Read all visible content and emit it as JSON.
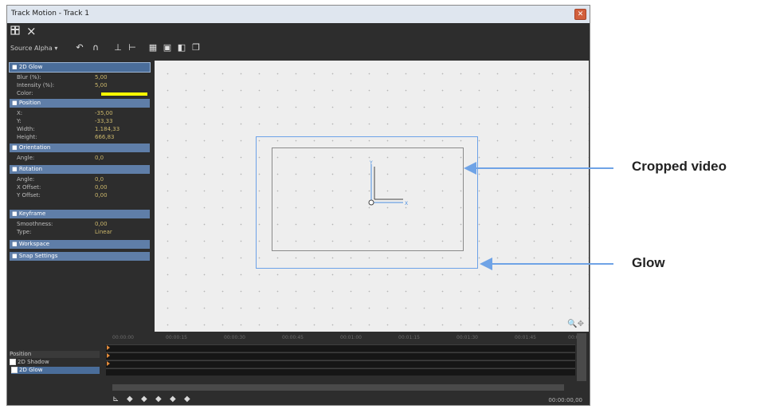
{
  "window": {
    "title": "Track Motion - Track 1",
    "close_glyph": "✕"
  },
  "toolbar_top": {
    "pin_icon": "pin-icon",
    "close_icon": "×"
  },
  "toolbar": {
    "source_label": "Source Alpha",
    "dropdown_glyph": "▾",
    "tools": [
      {
        "name": "undo-icon",
        "glyph": "↶"
      },
      {
        "name": "snap-magnet-icon",
        "glyph": "∩"
      },
      {
        "name": "align-bottom-icon",
        "glyph": "⊥"
      },
      {
        "name": "align-left-icon",
        "glyph": "⊢"
      },
      {
        "name": "grid-icon",
        "glyph": "▦"
      },
      {
        "name": "workspace-icon",
        "glyph": "▣"
      },
      {
        "name": "zoom-fit-icon",
        "glyph": "◧"
      },
      {
        "name": "copy-icon",
        "glyph": "❐"
      }
    ]
  },
  "properties": {
    "glow_header": "2D Glow",
    "glow": [
      {
        "label": "Blur (%):",
        "value": "5,00"
      },
      {
        "label": "Intensity (%):",
        "value": "5,00"
      },
      {
        "label": "Color:",
        "value": ""
      }
    ],
    "position_header": "Position",
    "position": [
      {
        "label": "X:",
        "value": "-35,00"
      },
      {
        "label": "Y:",
        "value": "-33,33"
      },
      {
        "label": "Width:",
        "value": "1.184,33"
      },
      {
        "label": "Height:",
        "value": "666,83"
      }
    ],
    "orientation_header": "Orientation",
    "orientation": [
      {
        "label": "Angle:",
        "value": "0,0"
      }
    ],
    "rotation_header": "Rotation",
    "rotation": [
      {
        "label": "Angle:",
        "value": "0,0"
      },
      {
        "label": "X Offset:",
        "value": "0,00"
      },
      {
        "label": "Y Offset:",
        "value": "0,00"
      }
    ],
    "keyframe_header": "Keyframe",
    "keyframe": [
      {
        "label": "Smoothness:",
        "value": "0,00"
      },
      {
        "label": "Type:",
        "value": "Linear"
      }
    ],
    "workspace_header": "Workspace",
    "snap_header": "Snap Settings",
    "glow_color": "#ffff00"
  },
  "canvas": {
    "axis_y_label": "Y",
    "axis_x_label": "X",
    "zoom_icons": "🔍✥"
  },
  "timeline": {
    "header_label": "Position",
    "items": [
      {
        "label": "2D Shadow",
        "checked": false
      },
      {
        "label": "2D Glow",
        "checked": true
      }
    ],
    "ruler_ticks": [
      "00:00:00",
      "00:00:15",
      "00:00:30",
      "00:00:45",
      "00:01:00",
      "00:01:15",
      "00:01:30",
      "00:01:45",
      "00:0"
    ],
    "timecode": "00:00:00,00",
    "keyframe_glyphs": [
      "◆",
      "◆",
      "◆",
      "◆",
      "◆"
    ]
  },
  "callouts": {
    "cropped": "Cropped video",
    "glow": "Glow"
  },
  "colors": {
    "accent": "#5f7ea8",
    "glow_border": "#6da2e8",
    "arrow": "#6fa3e6"
  }
}
